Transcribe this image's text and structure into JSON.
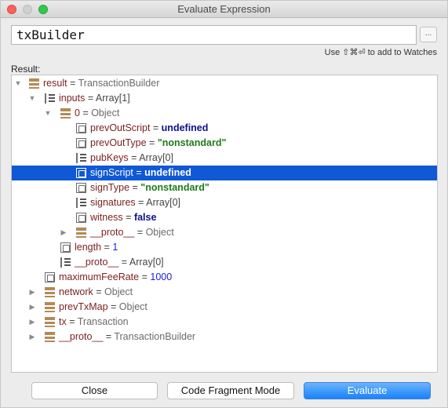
{
  "window": {
    "title": "Evaluate Expression"
  },
  "expression": {
    "value": "txBuilder",
    "more_label": "..."
  },
  "hint": "Use ⇧⌘⏎ to add to Watches",
  "result_label": "Result:",
  "tree": [
    {
      "icon": "object-icon",
      "arrow": "expanded",
      "name": "result",
      "eq": " = ",
      "value": "TransactionBuilder",
      "vtype": "v"
    },
    {
      "icon": "array-icon",
      "arrow": "expanded",
      "name": "inputs",
      "eq": " = ",
      "value": "Array[1]",
      "vtype": "eq"
    },
    {
      "icon": "object-icon",
      "arrow": "expanded",
      "name": "0",
      "eq": " = ",
      "value": "Object",
      "vtype": "v"
    },
    {
      "icon": "primitive-icon",
      "arrow": "",
      "name": "prevOutScript",
      "eq": " = ",
      "value": "undefined",
      "vtype": "kw"
    },
    {
      "icon": "primitive-icon",
      "arrow": "",
      "name": "prevOutType",
      "eq": " = ",
      "value": "\"nonstandard\"",
      "vtype": "str"
    },
    {
      "icon": "array-icon",
      "arrow": "",
      "name": "pubKeys",
      "eq": " = ",
      "value": "Array[0]",
      "vtype": "eq"
    },
    {
      "icon": "primitive-icon",
      "arrow": "",
      "name": "signScript",
      "eq": " = ",
      "value": "undefined",
      "vtype": "kw",
      "selected": true
    },
    {
      "icon": "primitive-icon",
      "arrow": "",
      "name": "signType",
      "eq": " = ",
      "value": "\"nonstandard\"",
      "vtype": "str"
    },
    {
      "icon": "array-icon",
      "arrow": "",
      "name": "signatures",
      "eq": " = ",
      "value": "Array[0]",
      "vtype": "eq"
    },
    {
      "icon": "primitive-icon",
      "arrow": "",
      "name": "witness",
      "eq": " = ",
      "value": "false",
      "vtype": "kw"
    },
    {
      "icon": "object-icon",
      "arrow": "collapsed",
      "name": "__proto__",
      "eq": " = ",
      "value": "Object",
      "vtype": "v"
    },
    {
      "icon": "primitive-icon",
      "arrow": "",
      "name": "length",
      "eq": " = ",
      "value": "1",
      "vtype": "num"
    },
    {
      "icon": "array-icon",
      "arrow": "",
      "name": "__proto__",
      "eq": " = ",
      "value": "Array[0]",
      "vtype": "eq"
    },
    {
      "icon": "primitive-icon",
      "arrow": "",
      "name": "maximumFeeRate",
      "eq": " = ",
      "value": "1000",
      "vtype": "num"
    },
    {
      "icon": "object-icon",
      "arrow": "collapsed",
      "name": "network",
      "eq": " = ",
      "value": "Object",
      "vtype": "v"
    },
    {
      "icon": "object-icon",
      "arrow": "collapsed",
      "name": "prevTxMap",
      "eq": " = ",
      "value": "Object",
      "vtype": "v"
    },
    {
      "icon": "object-icon",
      "arrow": "collapsed",
      "name": "tx",
      "eq": " = ",
      "value": "Transaction",
      "vtype": "v"
    },
    {
      "icon": "object-icon",
      "arrow": "collapsed",
      "name": "__proto__",
      "eq": " = ",
      "value": "TransactionBuilder",
      "vtype": "v"
    }
  ],
  "buttons": {
    "close": "Close",
    "code_fragment": "Code Fragment Mode",
    "evaluate": "Evaluate"
  }
}
